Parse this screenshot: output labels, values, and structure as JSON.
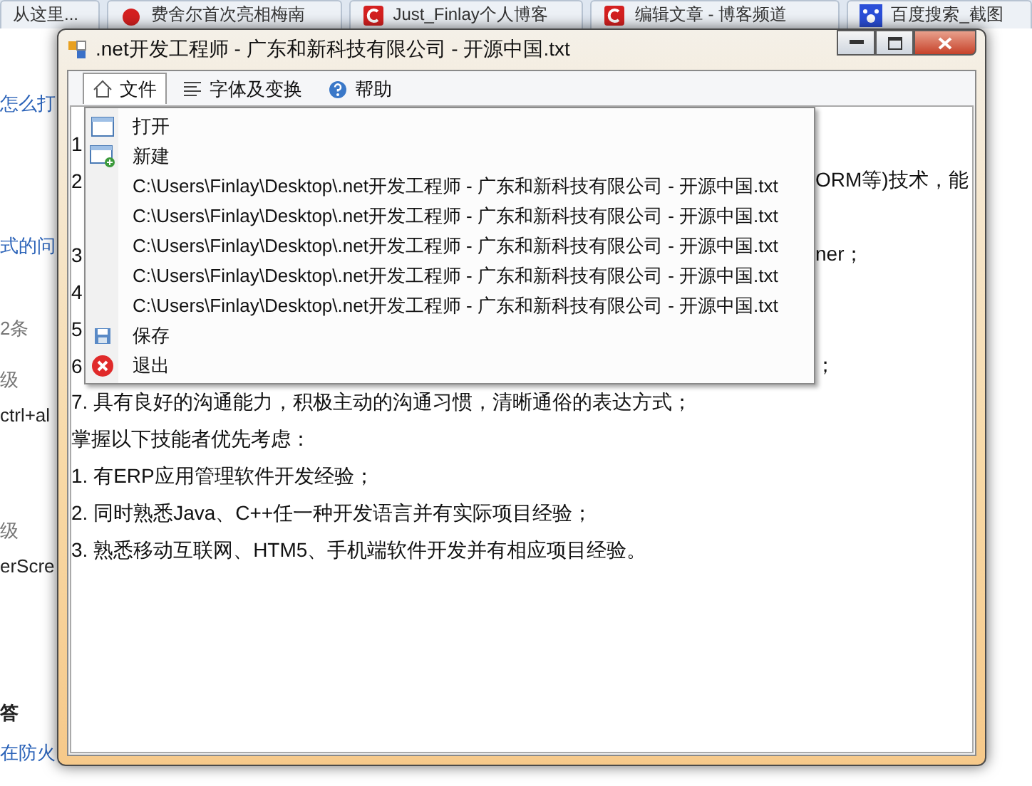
{
  "browser_tabs": [
    {
      "label": "从这里..."
    },
    {
      "label": "费舍尔首次亮相梅南"
    },
    {
      "label": "Just_Finlay个人博客"
    },
    {
      "label": "编辑文章 - 博客频道"
    },
    {
      "label": "百度搜索_截图"
    }
  ],
  "background_page": [
    {
      "text": "怎么打",
      "kind": "link"
    },
    {
      "text": "式的问",
      "kind": "link"
    },
    {
      "text": "2条",
      "kind": "meta"
    },
    {
      "text": "级",
      "kind": "meta"
    },
    {
      "text": "ctrl+al",
      "kind": "text"
    },
    {
      "text": "级",
      "kind": "meta"
    },
    {
      "text": "erScre",
      "kind": "text"
    },
    {
      "text": "答",
      "kind": "heading"
    },
    {
      "text": "在防火",
      "kind": "link"
    }
  ],
  "window": {
    "title": ".net开发工程师 - 广东和新科技有限公司 - 开源中国.txt"
  },
  "menubar": [
    {
      "label": "文件",
      "selected": true
    },
    {
      "label": "字体及变换",
      "selected": false
    },
    {
      "label": "帮助",
      "selected": false
    }
  ],
  "file_menu": [
    {
      "label": "打开",
      "kind": "open"
    },
    {
      "label": "新建",
      "kind": "new"
    },
    {
      "label": "C:\\Users\\Finlay\\Desktop\\.net开发工程师 - 广东和新科技有限公司 - 开源中国.txt",
      "kind": "recent"
    },
    {
      "label": "C:\\Users\\Finlay\\Desktop\\.net开发工程师 - 广东和新科技有限公司 - 开源中国.txt",
      "kind": "recent"
    },
    {
      "label": "C:\\Users\\Finlay\\Desktop\\.net开发工程师 - 广东和新科技有限公司 - 开源中国.txt",
      "kind": "recent"
    },
    {
      "label": "C:\\Users\\Finlay\\Desktop\\.net开发工程师 - 广东和新科技有限公司 - 开源中国.txt",
      "kind": "recent"
    },
    {
      "label": "C:\\Users\\Finlay\\Desktop\\.net开发工程师 - 广东和新科技有限公司 - 开源中国.txt",
      "kind": "recent"
    },
    {
      "label": "保存",
      "kind": "save"
    },
    {
      "label": "退出",
      "kind": "exit"
    }
  ],
  "editor": {
    "lines": [
      {
        "start": "1"
      },
      {
        "start": "2",
        "end": "ORM等)技术，能",
        "wrapped": true
      },
      {
        "start": "3",
        "end": "ner；"
      },
      {
        "start": "4"
      },
      {
        "start": "5"
      },
      {
        "start": "6",
        "end": "；"
      },
      {
        "start": "7. 具有良好的沟通能力，积极主动的沟通习惯，清晰通俗的表达方式；"
      },
      {
        "start": "掌握以下技能者优先考虑："
      },
      {
        "start": "1. 有ERP应用管理软件开发经验；"
      },
      {
        "start": "2. 同时熟悉Java、C++任一种开发语言并有实际项目经验；"
      },
      {
        "start": "3. 熟悉移动互联网、HTM5、手机端软件开发并有相应项目经验。"
      }
    ]
  }
}
